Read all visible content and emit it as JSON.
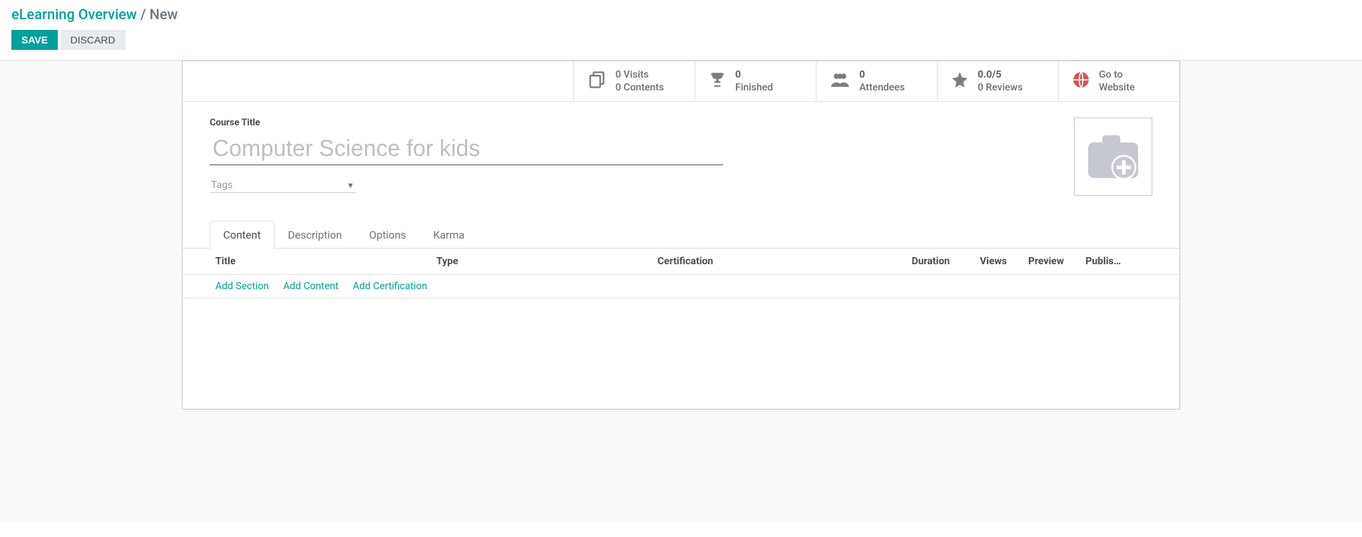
{
  "breadcrumb": {
    "parent": "eLearning Overview",
    "separator": "/",
    "current": "New"
  },
  "actions": {
    "save": "SAVE",
    "discard": "DISCARD"
  },
  "stats": {
    "visits_line1": "0 Visits",
    "visits_line2": "0 Contents",
    "finished_line1": "0",
    "finished_line2": "Finished",
    "attendees_line1": "0",
    "attendees_line2": "Attendees",
    "rating_line1": "0.0/5",
    "rating_line2": "0 Reviews",
    "goto_line1": "Go to",
    "goto_line2": "Website"
  },
  "fields": {
    "course_title_label": "Course Title",
    "course_title_placeholder": "Computer Science for kids",
    "tags_placeholder": "Tags"
  },
  "tabs": {
    "content": "Content",
    "description": "Description",
    "options": "Options",
    "karma": "Karma"
  },
  "table": {
    "headers": {
      "title": "Title",
      "type": "Type",
      "certification": "Certification",
      "duration": "Duration",
      "views": "Views",
      "preview": "Preview",
      "published": "Publis…"
    },
    "add_links": {
      "section": "Add Section",
      "content": "Add Content",
      "certification": "Add Certification"
    }
  }
}
